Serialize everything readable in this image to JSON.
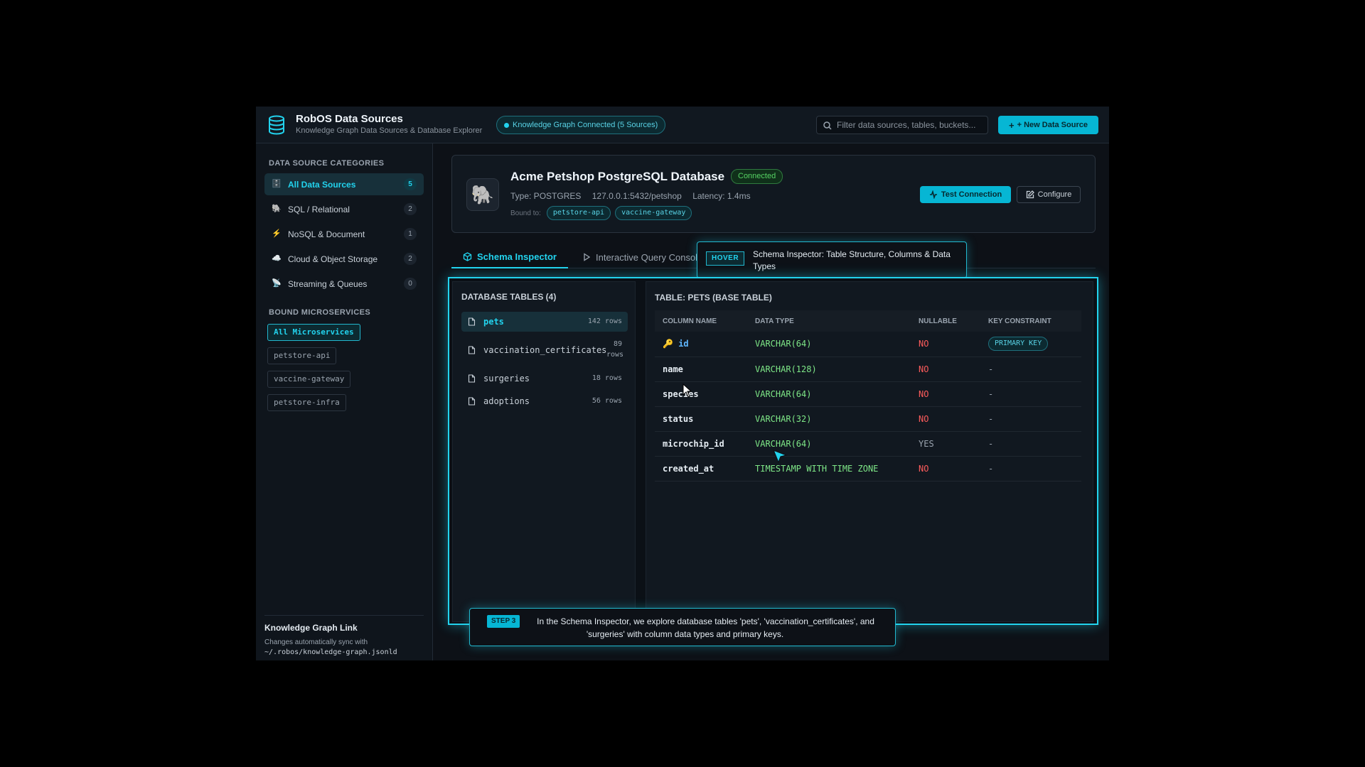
{
  "header": {
    "title": "RobOS Data Sources",
    "subtitle": "Knowledge Graph Data Sources & Database Explorer",
    "kg_status": "Knowledge Graph Connected (5 Sources)",
    "search_placeholder": "Filter data sources, tables, buckets...",
    "new_source_label": "+ New Data Source"
  },
  "sidebar": {
    "categories_heading": "DATA SOURCE CATEGORIES",
    "categories": [
      {
        "icon": "🗄️",
        "label": "All Data Sources",
        "count": "5"
      },
      {
        "icon": "🐘",
        "label": "SQL / Relational",
        "count": "2"
      },
      {
        "icon": "⚡",
        "label": "NoSQL & Document",
        "count": "1"
      },
      {
        "icon": "☁️",
        "label": "Cloud & Object Storage",
        "count": "2"
      },
      {
        "icon": "📡",
        "label": "Streaming & Queues",
        "count": "0"
      }
    ],
    "services_heading": "BOUND MICROSERVICES",
    "services": [
      "All Microservices",
      "petstore-api",
      "vaccine-gateway",
      "petstore-infra"
    ],
    "kg_link_title": "Knowledge Graph Link",
    "kg_link_desc": "Changes automatically sync with",
    "kg_link_path": "~/.robos/knowledge-graph.jsonld"
  },
  "source": {
    "logo": "🐘",
    "title": "Acme Petshop PostgreSQL Database",
    "status": "Connected",
    "type": "Type: POSTGRES",
    "host": "127.0.0.1:5432/petshop",
    "latency": "Latency: 1.4ms",
    "bound_label": "Bound to:",
    "bound": [
      "petstore-api",
      "vaccine-gateway"
    ],
    "test_label": "Test Connection",
    "configure_label": "Configure"
  },
  "tabs": {
    "schema": "Schema Inspector",
    "query": "Interactive Query Console"
  },
  "hover": {
    "badge": "HOVER",
    "text": "Schema Inspector: Table Structure, Columns & Data Types"
  },
  "tables": {
    "heading": "DATABASE TABLES (4)",
    "items": [
      {
        "name": "pets",
        "rows": "142 rows"
      },
      {
        "name": "vaccination_certificates",
        "rows": "89 rows"
      },
      {
        "name": "surgeries",
        "rows": "18 rows"
      },
      {
        "name": "adoptions",
        "rows": "56 rows"
      }
    ]
  },
  "columns": {
    "heading": "TABLE: PETS (BASE TABLE)",
    "headers": [
      "COLUMN NAME",
      "DATA TYPE",
      "NULLABLE",
      "KEY CONSTRAINT"
    ],
    "rows": [
      {
        "name": "id",
        "type": "VARCHAR(64)",
        "nullable": "NO",
        "key": "PRIMARY KEY"
      },
      {
        "name": "name",
        "type": "VARCHAR(128)",
        "nullable": "NO",
        "key": "-"
      },
      {
        "name": "species",
        "type": "VARCHAR(64)",
        "nullable": "NO",
        "key": "-"
      },
      {
        "name": "status",
        "type": "VARCHAR(32)",
        "nullable": "NO",
        "key": "-"
      },
      {
        "name": "microchip_id",
        "type": "VARCHAR(64)",
        "nullable": "YES",
        "key": "-"
      },
      {
        "name": "created_at",
        "type": "TIMESTAMP WITH TIME ZONE",
        "nullable": "NO",
        "key": "-"
      }
    ]
  },
  "step": {
    "badge": "STEP 3",
    "text": "In the Schema Inspector, we explore database tables 'pets', 'vaccination_certificates', and 'surgeries' with column data types and primary keys."
  },
  "colors": {
    "accent": "#22d3ee",
    "success": "#56d364",
    "danger": "#ff5c5c",
    "type_green": "#7ee787"
  }
}
